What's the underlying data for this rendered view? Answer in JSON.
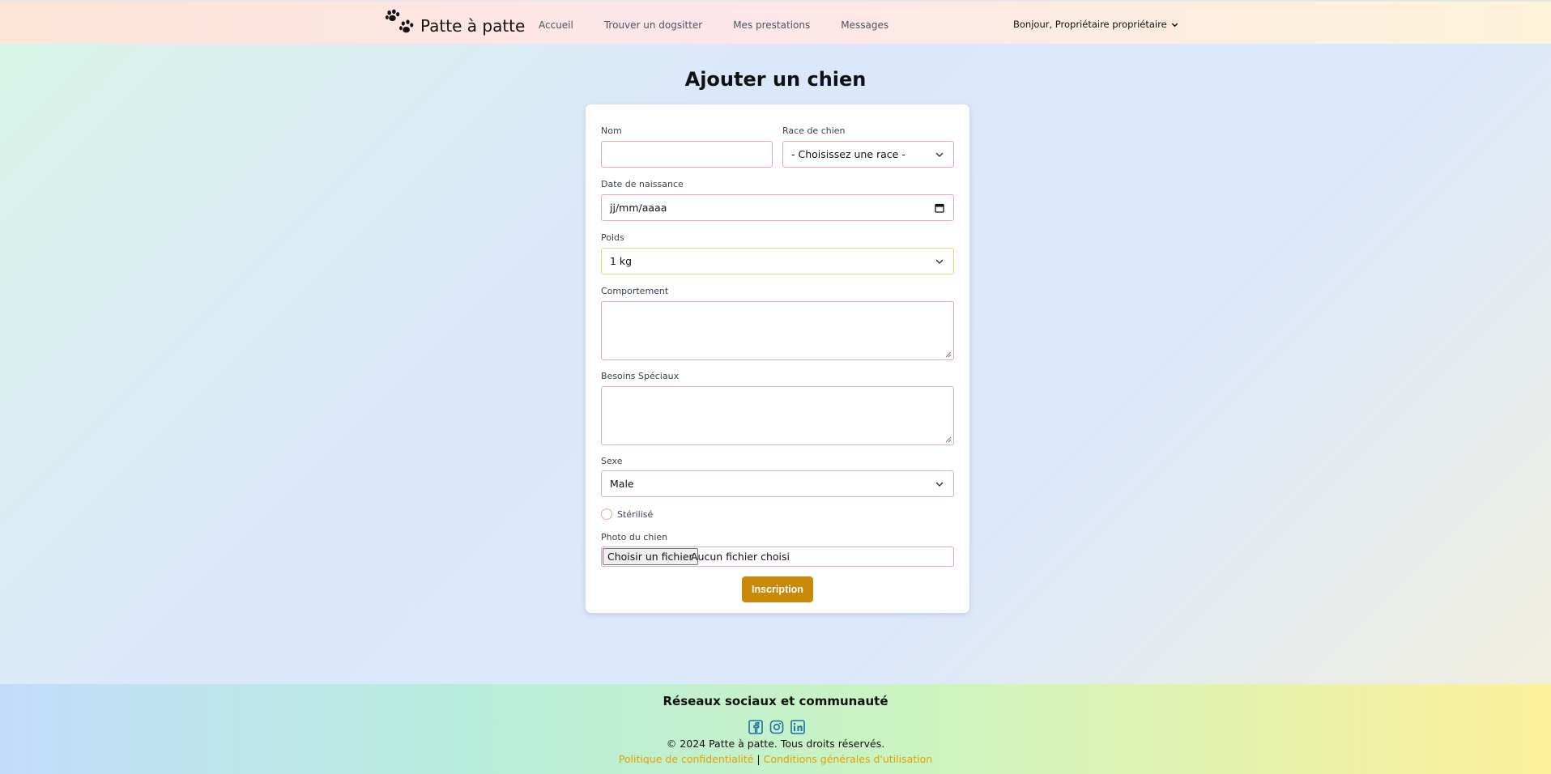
{
  "header": {
    "brand": "Patte à patte",
    "nav": [
      "Accueil",
      "Trouver un dogsitter",
      "Mes prestations",
      "Messages"
    ],
    "user_greeting": "Bonjour, Propriétaire propriétaire"
  },
  "page": {
    "title": "Ajouter un chien"
  },
  "form": {
    "nom_label": "Nom",
    "nom_value": "",
    "race_label": "Race de chien",
    "race_value": "- Choisissez une race -",
    "date_label": "Date de naissance",
    "date_placeholder": "jj/mm/aaaa",
    "poids_label": "Poids",
    "poids_value": "1 kg",
    "comportement_label": "Comportement",
    "besoins_label": "Besoins Spéciaux",
    "sexe_label": "Sexe",
    "sexe_value": "Male",
    "sterilise_label": "Stérilisé",
    "photo_label": "Photo du chien",
    "file_button": "Choisir un fichier",
    "file_status": "Aucun fichier choisi",
    "submit": "Inscription"
  },
  "footer": {
    "title": "Réseaux sociaux et communauté",
    "socials": [
      "facebook-icon",
      "instagram-icon",
      "linkedin-icon"
    ],
    "copyright": "© 2024 Patte à patte. Tous droits réservés.",
    "privacy": "Politique de confidentialité",
    "separator": "|",
    "terms": "Conditions générales d'utilisation"
  },
  "colors": {
    "accent": "#c98a0c",
    "field_border": "#f2a4b0",
    "link": "#e0a100",
    "social": "#1d6fa5"
  }
}
